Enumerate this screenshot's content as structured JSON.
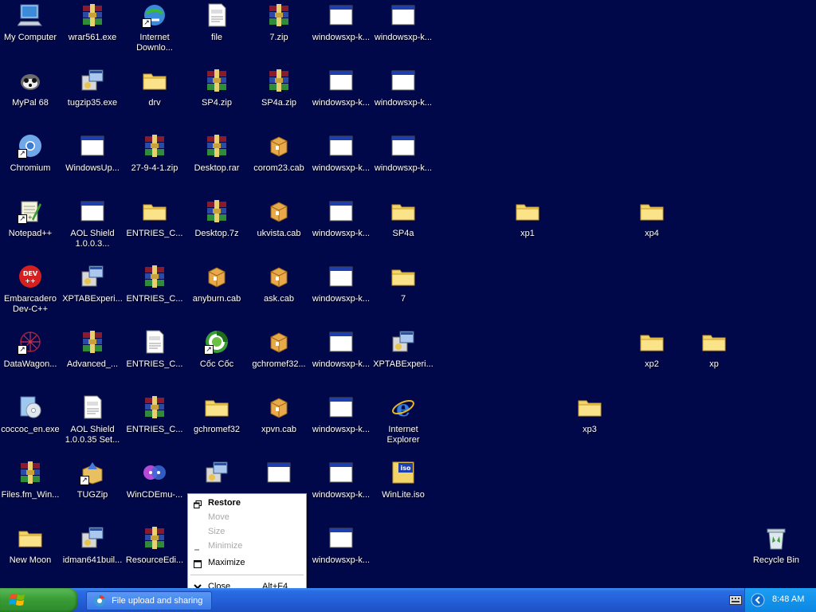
{
  "desktop": {
    "icons": [
      {
        "label": "My Computer",
        "icon": "computer-icon",
        "shortcut": false
      },
      {
        "label": "wrar561.exe",
        "icon": "winrar-icon",
        "shortcut": false
      },
      {
        "label": "Internet Downlo...",
        "icon": "idm-icon",
        "shortcut": true
      },
      {
        "label": "file",
        "icon": "document-icon",
        "shortcut": false
      },
      {
        "label": "7.zip",
        "icon": "winrar-icon",
        "shortcut": false
      },
      {
        "label": "windowsxp-k...",
        "icon": "window-icon",
        "shortcut": false
      },
      {
        "label": "windowsxp-k...",
        "icon": "window-icon",
        "shortcut": false
      },
      {
        "label": "MyPal 68",
        "icon": "mypal-icon",
        "shortcut": false
      },
      {
        "label": "tugzip35.exe",
        "icon": "installer-icon",
        "shortcut": false
      },
      {
        "label": "drv",
        "icon": "folder-icon",
        "shortcut": false
      },
      {
        "label": "SP4.zip",
        "icon": "winrar-icon",
        "shortcut": false
      },
      {
        "label": "SP4a.zip",
        "icon": "winrar-icon",
        "shortcut": false
      },
      {
        "label": "windowsxp-k...",
        "icon": "window-icon",
        "shortcut": false
      },
      {
        "label": "windowsxp-k...",
        "icon": "window-icon",
        "shortcut": false
      },
      {
        "label": "Chromium",
        "icon": "chromium-icon",
        "shortcut": true
      },
      {
        "label": "WindowsUp...",
        "icon": "window-icon",
        "shortcut": false
      },
      {
        "label": "27-9-4-1.zip",
        "icon": "winrar-icon",
        "shortcut": false
      },
      {
        "label": "Desktop.rar",
        "icon": "winrar-icon",
        "shortcut": false
      },
      {
        "label": "corom23.cab",
        "icon": "cab-icon",
        "shortcut": false
      },
      {
        "label": "windowsxp-k...",
        "icon": "window-icon",
        "shortcut": false
      },
      {
        "label": "windowsxp-k...",
        "icon": "window-icon",
        "shortcut": false
      },
      {
        "label": "Notepad++",
        "icon": "notepad-icon",
        "shortcut": true
      },
      {
        "label": "AOL Shield 1.0.0.3...",
        "icon": "window-icon",
        "shortcut": false
      },
      {
        "label": "ENTRIES_C...",
        "icon": "folder-icon",
        "shortcut": false
      },
      {
        "label": "Desktop.7z",
        "icon": "winrar-icon",
        "shortcut": false
      },
      {
        "label": "ukvista.cab",
        "icon": "cab-icon",
        "shortcut": false
      },
      {
        "label": "windowsxp-k...",
        "icon": "window-icon",
        "shortcut": false
      },
      {
        "label": "SP4a",
        "icon": "folder-icon",
        "shortcut": false
      },
      {
        "label": "xp1",
        "icon": "folder-icon",
        "shortcut": false
      },
      {
        "label": "xp4",
        "icon": "folder-icon",
        "shortcut": false
      },
      {
        "label": "Embarcadero Dev-C++",
        "icon": "devcpp-icon",
        "shortcut": false
      },
      {
        "label": "XPTABExperi...",
        "icon": "installer-icon",
        "shortcut": false
      },
      {
        "label": "ENTRIES_C...",
        "icon": "winrar-icon",
        "shortcut": false
      },
      {
        "label": "anyburn.cab",
        "icon": "cab-icon",
        "shortcut": false
      },
      {
        "label": "ask.cab",
        "icon": "cab-icon",
        "shortcut": false
      },
      {
        "label": "windowsxp-k...",
        "icon": "window-icon",
        "shortcut": false
      },
      {
        "label": "7",
        "icon": "folder-icon",
        "shortcut": false
      },
      {
        "label": "DataWagon...",
        "icon": "datawagon-icon",
        "shortcut": true
      },
      {
        "label": "Advanced_...",
        "icon": "winrar-icon",
        "shortcut": false
      },
      {
        "label": "ENTRIES_C...",
        "icon": "document-icon",
        "shortcut": false
      },
      {
        "label": "Cốc Cốc",
        "icon": "coccoc-icon",
        "shortcut": true
      },
      {
        "label": "gchromef32...",
        "icon": "cab-icon",
        "shortcut": false
      },
      {
        "label": "windowsxp-k...",
        "icon": "window-icon",
        "shortcut": false
      },
      {
        "label": "XPTABExperi...",
        "icon": "installer-icon",
        "shortcut": false
      },
      {
        "label": "xp2",
        "icon": "folder-icon",
        "shortcut": false
      },
      {
        "label": "xp",
        "icon": "folder-icon",
        "shortcut": false
      },
      {
        "label": "coccoc_en.exe",
        "icon": "installer-cd-icon",
        "shortcut": false
      },
      {
        "label": "AOL Shield 1.0.0.35 Set...",
        "icon": "document-icon",
        "shortcut": false
      },
      {
        "label": "ENTRIES_C...",
        "icon": "winrar-icon",
        "shortcut": false
      },
      {
        "label": "gchromef32",
        "icon": "folder-icon",
        "shortcut": false
      },
      {
        "label": "xpvn.cab",
        "icon": "cab-icon",
        "shortcut": false
      },
      {
        "label": "windowsxp-k...",
        "icon": "window-icon",
        "shortcut": false
      },
      {
        "label": "Internet Explorer",
        "icon": "ie-icon",
        "shortcut": false
      },
      {
        "label": "xp3",
        "icon": "folder-icon",
        "shortcut": false
      },
      {
        "label": "Files.fm_Win...",
        "icon": "winrar-icon",
        "shortcut": false
      },
      {
        "label": "TUGZip",
        "icon": "tugzip-icon",
        "shortcut": true
      },
      {
        "label": "WinCDEmu-...",
        "icon": "wincdemu-icon",
        "shortcut": false
      },
      {
        "label": "",
        "icon": "installer-icon",
        "shortcut": false
      },
      {
        "label": "",
        "icon": "window-icon",
        "shortcut": false
      },
      {
        "label": "windowsxp-k...",
        "icon": "window-icon",
        "shortcut": false
      },
      {
        "label": "WinLite.iso",
        "icon": "iso-icon",
        "shortcut": false
      },
      {
        "label": "New Moon",
        "icon": "folder-icon",
        "shortcut": false
      },
      {
        "label": "idman641buil...",
        "icon": "installer-icon",
        "shortcut": false
      },
      {
        "label": "ResourceEdi...",
        "icon": "winrar-icon",
        "shortcut": false
      },
      {
        "label": "windowsxp-k...",
        "icon": "window-icon",
        "shortcut": false
      },
      {
        "label": "Recycle Bin",
        "icon": "recycle-bin-icon",
        "shortcut": false
      }
    ]
  },
  "context_menu": {
    "items": [
      {
        "label": "Restore",
        "icon": "restore-icon",
        "enabled": true,
        "bold": true,
        "accel": ""
      },
      {
        "label": "Move",
        "icon": "",
        "enabled": false,
        "bold": false,
        "accel": ""
      },
      {
        "label": "Size",
        "icon": "",
        "enabled": false,
        "bold": false,
        "accel": ""
      },
      {
        "label": "Minimize",
        "icon": "minimize-icon",
        "enabled": false,
        "bold": false,
        "accel": ""
      },
      {
        "label": "Maximize",
        "icon": "maximize-icon",
        "enabled": true,
        "bold": false,
        "accel": ""
      },
      {
        "label": "Close",
        "icon": "close-icon",
        "enabled": true,
        "bold": false,
        "accel": "Alt+F4"
      }
    ]
  },
  "taskbar": {
    "task_button_label": "File upload and sharing",
    "clock": "8:48 AM"
  }
}
